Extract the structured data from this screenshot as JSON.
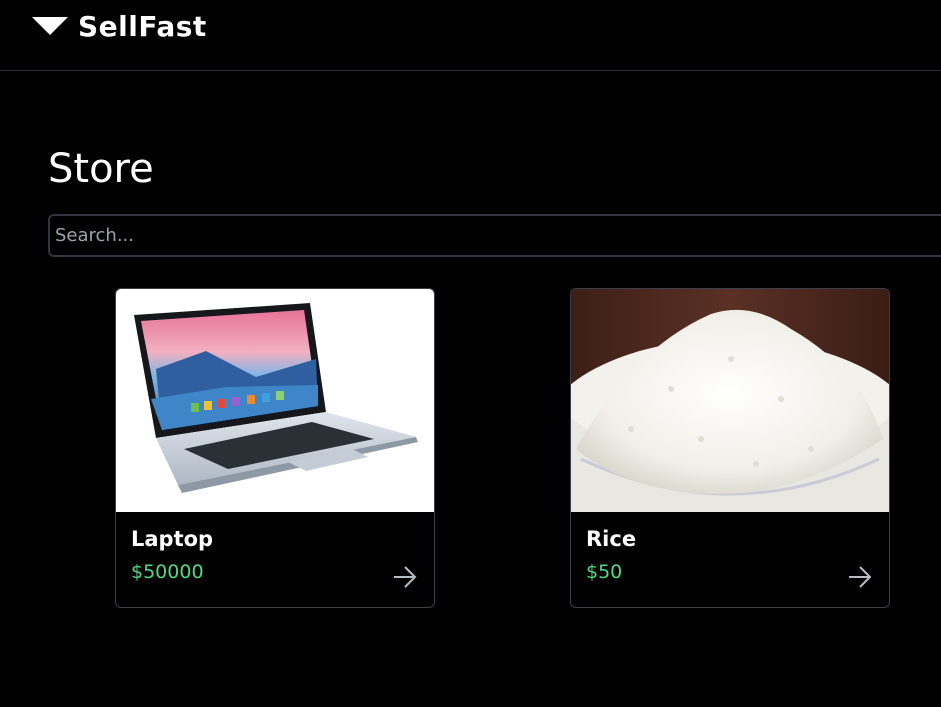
{
  "header": {
    "brand_name": "SellFast",
    "brand_icon": "triangle-down-icon"
  },
  "main": {
    "title": "Store",
    "search": {
      "placeholder": "Search...",
      "value": ""
    }
  },
  "colors": {
    "background": "#000000",
    "price": "#4ade80",
    "border": "#3a3f4a",
    "muted_text": "#9ca3af"
  },
  "products": [
    {
      "name": "Laptop",
      "price": "$50000",
      "image": "laptop-photo",
      "action_icon": "arrow-right-icon"
    },
    {
      "name": "Rice",
      "price": "$50",
      "image": "rice-bowl-photo",
      "action_icon": "arrow-right-icon"
    }
  ]
}
